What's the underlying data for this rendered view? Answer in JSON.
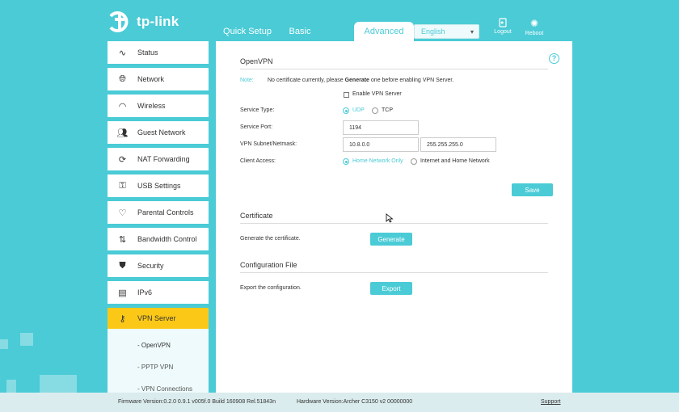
{
  "header": {
    "logo_text": "tp-link",
    "tabs": [
      {
        "label": "Quick Setup"
      },
      {
        "label": "Basic"
      },
      {
        "label": "Advanced"
      }
    ],
    "language": "English",
    "logout_label": "Logout",
    "reboot_label": "Reboot"
  },
  "sidebar": {
    "items": [
      {
        "label": "Status",
        "icon": "pulse-icon"
      },
      {
        "label": "Network",
        "icon": "globe-icon"
      },
      {
        "label": "Wireless",
        "icon": "wifi-icon"
      },
      {
        "label": "Guest Network",
        "icon": "users-icon"
      },
      {
        "label": "NAT Forwarding",
        "icon": "nat-icon"
      },
      {
        "label": "USB Settings",
        "icon": "usb-icon"
      },
      {
        "label": "Parental Controls",
        "icon": "heart-icon"
      },
      {
        "label": "Bandwidth Control",
        "icon": "bandwidth-icon"
      },
      {
        "label": "Security",
        "icon": "shield-icon"
      },
      {
        "label": "IPv6",
        "icon": "ipv6-icon"
      },
      {
        "label": "VPN Server",
        "icon": "key-icon"
      }
    ],
    "sub_items": [
      {
        "label": "- OpenVPN"
      },
      {
        "label": "- PPTP VPN"
      },
      {
        "label": "- VPN Connections"
      }
    ]
  },
  "openvpn": {
    "title": "OpenVPN",
    "note_label": "Note:",
    "note_text_1": "No certificate currently, please",
    "note_text_bold": "Generate",
    "note_text_2": "one before enabling VPN Server.",
    "enable_label": "Enable VPN Server",
    "service_type_label": "Service Type:",
    "udp_label": "UDP",
    "tcp_label": "TCP",
    "service_port_label": "Service Port:",
    "service_port_value": "1194",
    "subnet_label": "VPN Subnet/Netmask:",
    "subnet_value": "10.8.0.0",
    "netmask_value": "255.255.255.0",
    "client_access_label": "Client Access:",
    "home_only_label": "Home Network Only",
    "internet_home_label": "Internet and Home Network",
    "save_label": "Save"
  },
  "certificate": {
    "title": "Certificate",
    "desc": "Generate the certificate.",
    "button": "Generate"
  },
  "config_file": {
    "title": "Configuration File",
    "desc": "Export the configuration.",
    "button": "Export"
  },
  "footer": {
    "firmware": "Firmware Version:0.2.0 0.9.1 v005f.0 Build 160908 Rel.51843n",
    "hardware": "Hardware Version:Archer C3150 v2 00000000",
    "support": "Support"
  },
  "colors": {
    "accent": "#4acbd6",
    "active_menu": "#fcc818"
  }
}
